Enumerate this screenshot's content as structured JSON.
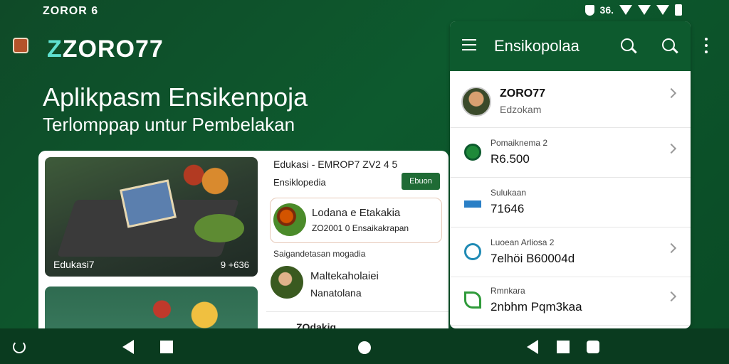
{
  "status_bar": {
    "left_text": "ZOROR 6",
    "right_text": "36."
  },
  "header": {
    "brand_prefix": "Z",
    "brand_rest": "ZORO77",
    "title": "Aplikpasm Ensikenpoja",
    "subtitle": "Terlomppap untur Pembelakan"
  },
  "card": {
    "photo1_caption_left": "Edukasi7",
    "photo1_caption_right": "9 +636",
    "right_header": "Edukasi   - EMROP7 ZV2",
    "right_header_signal": "4 5",
    "section_label": "Ensiklopedia",
    "action_button": "Ebuon",
    "item1": {
      "title": "Lodana e Etakakia",
      "subtitle": "ZO2001 0 Ensaikakrapan"
    },
    "section_label2": "Saigandetasan mogadia",
    "item2": {
      "title": "Maltekaholaiei",
      "subtitle": "Nanatolana"
    },
    "bottom_text": "ZOdakiq"
  },
  "panel": {
    "title": "Ensikopolaa",
    "profile": {
      "name": "ZORO77",
      "subtitle": "Edzokam"
    },
    "rows": [
      {
        "label": "Pomaiknema 2",
        "value": "R6.500",
        "icon": "location-pin-icon"
      },
      {
        "label": "Sulukaan",
        "value": "71646",
        "icon": "card-icon"
      },
      {
        "label": "Luoean Arliosa 2",
        "value": "7elhöi B60004d",
        "icon": "cycle-icon"
      },
      {
        "label": "Rmnkara",
        "value": "2nbhm Pqm3kaa",
        "icon": "leaf-icon"
      }
    ]
  }
}
